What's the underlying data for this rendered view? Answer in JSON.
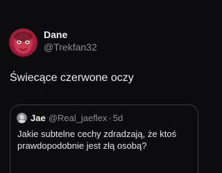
{
  "tweet": {
    "author": {
      "display_name": "Dane",
      "handle": "@Trekfan32",
      "avatar_icon": "profile-avatar-icon"
    },
    "text": "Świecące czerwone oczy"
  },
  "quoted_tweet": {
    "author": {
      "display_name": "Jae",
      "handle": "@Real_jaeflex",
      "avatar_icon": "profile-avatar-icon"
    },
    "separator": "·",
    "time": "5d",
    "text": "Jakie subtelne cechy zdradzają, że ktoś prawdopodobnie jest złą osobą?"
  },
  "colors": {
    "background": "#0c0c0e",
    "primary_text": "#ededf0",
    "secondary_text": "#8b8e93",
    "border": "#3a3b40",
    "avatar_red": "#c42a47"
  }
}
